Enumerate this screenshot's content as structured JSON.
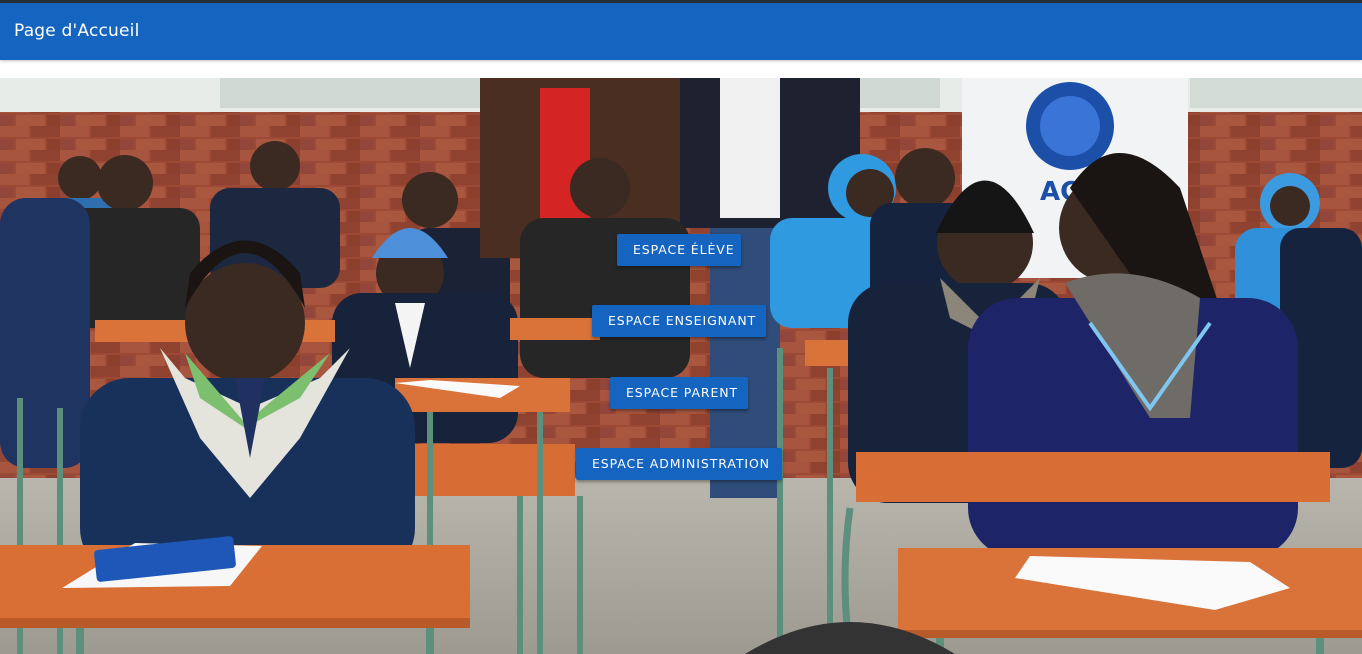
{
  "header": {
    "title": "Page d'Accueil"
  },
  "hero": {
    "image_subject": "classroom-students-photo",
    "logo_text": "ACCU"
  },
  "buttons": {
    "eleve": "Espace élève",
    "enseignant": "Espace Enseignant",
    "parent": "Espace Parent",
    "administration": "Espace Administration"
  },
  "colors": {
    "primary": "#1565c0",
    "button_text": "#ffffff"
  }
}
